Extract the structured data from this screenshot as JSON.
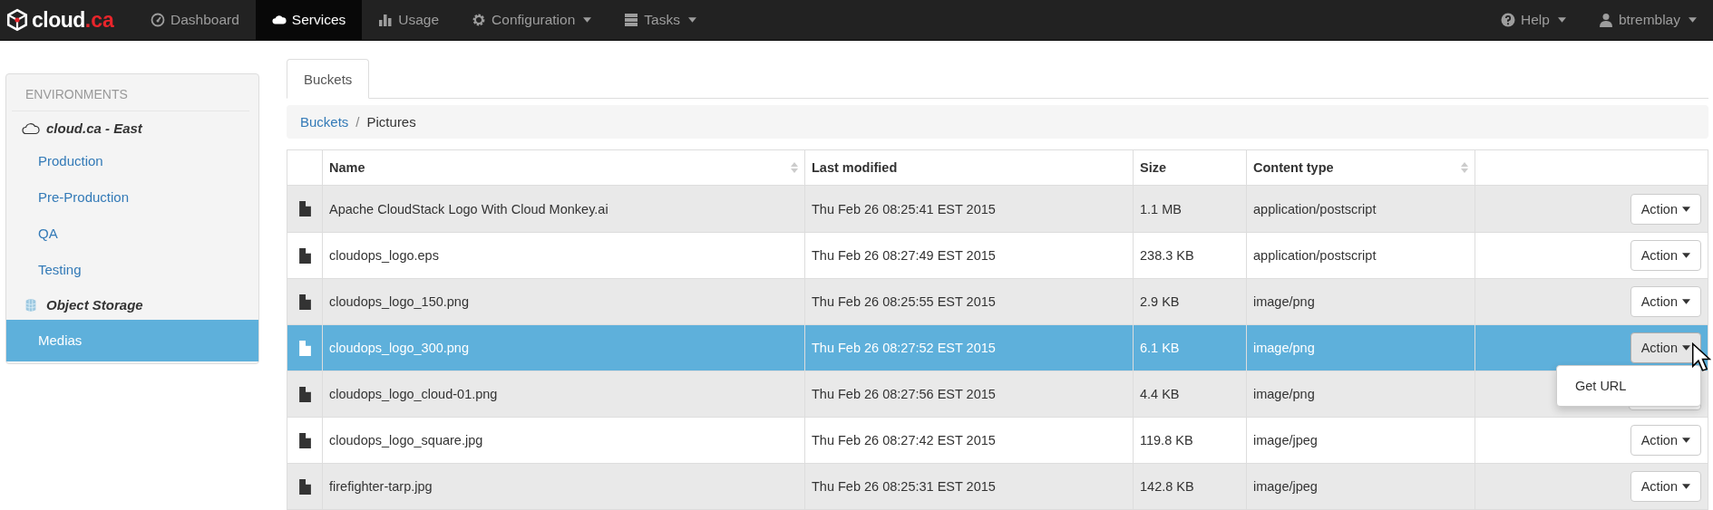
{
  "navbar": {
    "brand": {
      "prefix": "cloud",
      "suffix": ".ca"
    },
    "items": [
      {
        "label": "Dashboard",
        "selected": false,
        "dropdown": false
      },
      {
        "label": "Services",
        "selected": true,
        "dropdown": false
      },
      {
        "label": "Usage",
        "selected": false,
        "dropdown": false
      },
      {
        "label": "Configuration",
        "selected": false,
        "dropdown": true
      },
      {
        "label": "Tasks",
        "selected": false,
        "dropdown": true
      }
    ],
    "right": [
      {
        "label": "Help",
        "dropdown": true
      },
      {
        "label": "btremblay",
        "dropdown": true
      }
    ]
  },
  "sidebar": {
    "heading": "ENVIRONMENTS",
    "groups": [
      {
        "label": "cloud.ca - East",
        "items": [
          {
            "label": "Production",
            "selected": false
          },
          {
            "label": "Pre-Production",
            "selected": false
          },
          {
            "label": "QA",
            "selected": false
          },
          {
            "label": "Testing",
            "selected": false
          }
        ]
      },
      {
        "label": "Object Storage",
        "items": [
          {
            "label": "Medias",
            "selected": true
          }
        ]
      }
    ]
  },
  "tabs": [
    {
      "label": "Buckets",
      "selected": true
    }
  ],
  "breadcrumb": {
    "separator": "/",
    "items": [
      {
        "label": "Buckets",
        "link": true
      },
      {
        "label": "Pictures",
        "link": false
      }
    ]
  },
  "table": {
    "columns": [
      {
        "label": "Name",
        "sortable": true
      },
      {
        "label": "Last modified",
        "sortable": false
      },
      {
        "label": "Size",
        "sortable": false
      },
      {
        "label": "Content type",
        "sortable": true
      }
    ],
    "rows": [
      {
        "name": "Apache CloudStack Logo With Cloud Monkey.ai",
        "modified": "Thu Feb 26 08:25:41 EST 2015",
        "size": "1.1 MB",
        "type": "application/postscript",
        "selected": false,
        "action": "Action"
      },
      {
        "name": "cloudops_logo.eps",
        "modified": "Thu Feb 26 08:27:49 EST 2015",
        "size": "238.3 KB",
        "type": "application/postscript",
        "selected": false,
        "action": "Action"
      },
      {
        "name": "cloudops_logo_150.png",
        "modified": "Thu Feb 26 08:25:55 EST 2015",
        "size": "2.9 KB",
        "type": "image/png",
        "selected": false,
        "action": "Action"
      },
      {
        "name": "cloudops_logo_300.png",
        "modified": "Thu Feb 26 08:27:52 EST 2015",
        "size": "6.1 KB",
        "type": "image/png",
        "selected": true,
        "action": "Action",
        "menu": [
          "Get URL"
        ]
      },
      {
        "name": "cloudops_logo_cloud-01.png",
        "modified": "Thu Feb 26 08:27:56 EST 2015",
        "size": "4.4 KB",
        "type": "image/png",
        "selected": false
      },
      {
        "name": "cloudops_logo_square.jpg",
        "modified": "Thu Feb 26 08:27:42 EST 2015",
        "size": "119.8 KB",
        "type": "image/jpeg",
        "selected": false,
        "action": "Action"
      },
      {
        "name": "firefighter-tarp.jpg",
        "modified": "Thu Feb 26 08:25:31 EST 2015",
        "size": "142.8 KB",
        "type": "image/jpeg",
        "selected": false,
        "action": "Action"
      }
    ]
  }
}
